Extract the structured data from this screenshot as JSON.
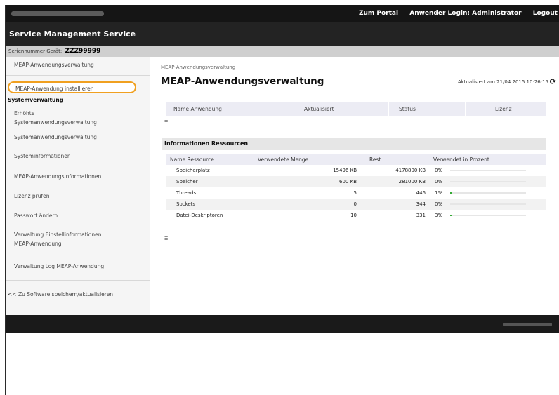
{
  "topbar": {
    "portal_link": "Zum Portal",
    "login_label": "Anwender Login: Administrator",
    "logout_label": "Logout"
  },
  "service": {
    "title": "Service Management Service"
  },
  "serial": {
    "label": "Seriennummer Gerät:",
    "value": "ZZZ99999"
  },
  "sidebar": {
    "items": [
      {
        "label": "MEAP-Anwendungsverwaltung"
      },
      {
        "label": "MEAP-Anwendung installieren"
      },
      {
        "label": "Systemverwaltung"
      },
      {
        "label": "Erhöhte\nSystemanwendungsverwaltung"
      },
      {
        "label": "Systemanwendungsverwaltung"
      },
      {
        "label": "Systeminformationen"
      },
      {
        "label": "MEAP-Anwendungsinformationen"
      },
      {
        "label": "Lizenz prüfen"
      },
      {
        "label": "Passwort ändern"
      },
      {
        "label": "Verwaltung Einstellinformationen\nMEAP-Anwendung"
      },
      {
        "label": "Verwaltung Log MEAP-Anwendung"
      },
      {
        "label": "<< Zu Software speichern/aktualisieren"
      }
    ]
  },
  "main": {
    "breadcrumb": "MEAP-Anwendungsverwaltung",
    "title": "MEAP-Anwendungsverwaltung",
    "updated": "Aktualisiert am 21/04 2015 10:26:15",
    "app_table": {
      "headers": [
        "Name Anwendung",
        "Aktualisiert",
        "Status",
        "Lizenz"
      ]
    },
    "collapse_icon": "collapse-up-icon",
    "resources": {
      "title": "Informationen Ressourcen",
      "headers": [
        "Name Ressource",
        "Verwendete Menge",
        "Rest",
        "Verwendet in Prozent"
      ],
      "rows": [
        {
          "name": "Speicherplatz",
          "used": "15496 KB",
          "rest": "4178800 KB",
          "percent": "0%",
          "fraction": 0.0
        },
        {
          "name": "Speicher",
          "used": "600 KB",
          "rest": "281000 KB",
          "percent": "0%",
          "fraction": 0.0
        },
        {
          "name": "Threads",
          "used": "5",
          "rest": "446",
          "percent": "1%",
          "fraction": 0.01
        },
        {
          "name": "Sockets",
          "used": "0",
          "rest": "344",
          "percent": "0%",
          "fraction": 0.0
        },
        {
          "name": "Datei-Deskriptoren",
          "used": "10",
          "rest": "331",
          "percent": "3%",
          "fraction": 0.03
        }
      ]
    }
  },
  "colors": {
    "bar_fill": "#33aa33",
    "highlight": "#f0a020"
  }
}
